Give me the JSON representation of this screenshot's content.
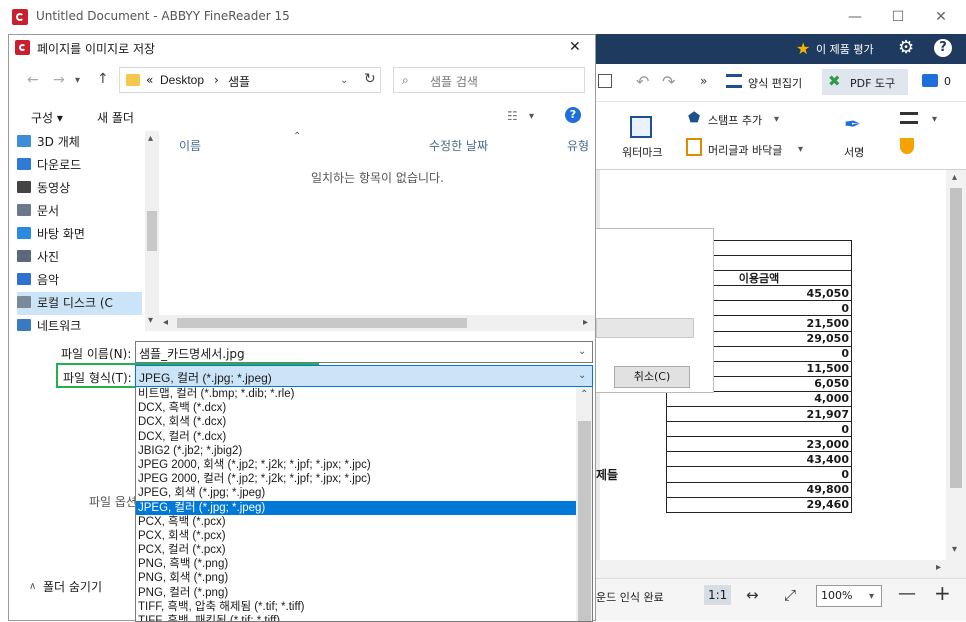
{
  "app": {
    "title": "Untitled Document - ABBYY FineReader 15",
    "rate_label": "이 제품 평가",
    "toolbar": {
      "form_editor": "양식 편집기",
      "pdf_tools": "PDF 도구",
      "comment_count": "0",
      "more": "»"
    },
    "ribbon": {
      "watermark": "워터마크",
      "add_stamp": "스탬프 추가",
      "header_footer": "머리글과 바닥글",
      "signature": "서명"
    },
    "document": {
      "column_header": "이용금액",
      "side_text": "제들",
      "amounts": [
        "45,050",
        "0",
        "21,500",
        "29,050",
        "0",
        "11,500",
        "6,050",
        "4,000",
        "21,907",
        "0",
        "23,000",
        "43,400",
        "0",
        "49,800",
        "29,460"
      ]
    },
    "progress": {
      "cancel_label": "취소(C)"
    },
    "status": {
      "text": "운드 인식 완료",
      "zoom": "100%",
      "ratio": "1:1"
    }
  },
  "dialog": {
    "title": "페이지를 이미지로 저장",
    "close": "✕",
    "address": {
      "prefix": "«",
      "part1": "Desktop",
      "sep": "›",
      "part2": "샘플"
    },
    "search_placeholder": "샘플 검색",
    "cmd": {
      "organize": "구성 ▾",
      "new_folder": "새 폴더"
    },
    "nav_items": [
      {
        "label": "3D 개체",
        "color": "#3c8ed8"
      },
      {
        "label": "다운로드",
        "color": "#2f7ad6"
      },
      {
        "label": "동영상",
        "color": "#444444"
      },
      {
        "label": "문서",
        "color": "#6a7a8a"
      },
      {
        "label": "바탕 화면",
        "color": "#2a8ae0"
      },
      {
        "label": "사진",
        "color": "#5a6a7a"
      },
      {
        "label": "음악",
        "color": "#2f6fd0"
      },
      {
        "label": "로컬 디스크 (C",
        "color": "#7a8a9a"
      },
      {
        "label": "네트워크",
        "color": "#3a7ac0"
      }
    ],
    "columns": {
      "name": "이름",
      "modified": "수정한 날짜",
      "type": "유형"
    },
    "empty_message": "일치하는 항목이 없습니다.",
    "filename_label": "파일 이름(N):",
    "filename_value": "샘플_카드명세서.jpg",
    "filetype_label": "파일 형식(T):",
    "filetype_value": "JPEG, 컬러 (*.jpg; *.jpeg)",
    "options_label": "파일 옵션",
    "hide_folders": "폴더 숨기기",
    "filetype_options": [
      "비트맵, 컬러 (*.bmp; *.dib; *.rle)",
      "DCX, 흑백 (*.dcx)",
      "DCX, 회색 (*.dcx)",
      "DCX, 컬러 (*.dcx)",
      "JBIG2 (*.jb2; *.jbig2)",
      "JPEG 2000, 회색 (*.jp2; *.j2k; *.jpf; *.jpx; *.jpc)",
      "JPEG 2000, 컬러 (*.jp2; *.j2k; *.jpf; *.jpx; *.jpc)",
      "JPEG, 회색 (*.jpg; *.jpeg)",
      "JPEG, 컬러 (*.jpg; *.jpeg)",
      "PCX, 흑백 (*.pcx)",
      "PCX, 회색 (*.pcx)",
      "PCX, 컬러 (*.pcx)",
      "PNG, 흑백 (*.png)",
      "PNG, 회색 (*.png)",
      "PNG, 컬러 (*.png)",
      "TIFF, 흑백, 압축 해제됨 (*.tif; *.tiff)",
      "TIFF, 흑백, 패킷됨 (*.tif; *.tiff)"
    ],
    "selected_index": 8
  },
  "colors": {
    "accent": "#0078d7",
    "highlight_border": "#22b14c",
    "app_dark": "#1e3a5f",
    "abbyy_red": "#c8202f"
  }
}
